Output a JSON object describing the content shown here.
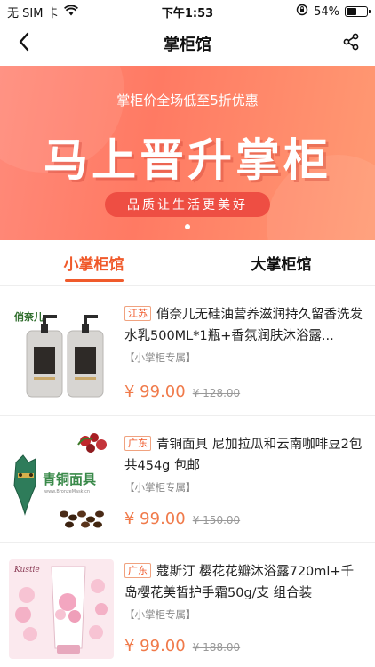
{
  "status_bar": {
    "carrier": "无 SIM 卡",
    "time": "下午1:53",
    "battery_percent": "54%",
    "battery_level": 0.54
  },
  "nav": {
    "title": "掌柜馆",
    "back_icon": "chevron-left-icon",
    "share_icon": "share-icon"
  },
  "banner": {
    "subtitle": "掌柜价全场低至5折优惠",
    "headline": "马上晋升掌柜",
    "pill_text": "品质让生活更美好",
    "colors": {
      "start": "#ff8a7a",
      "end": "#ff9a73",
      "pill": "#ee4e43"
    }
  },
  "tabs": [
    {
      "label": "小掌柜馆",
      "active": true
    },
    {
      "label": "大掌柜馆",
      "active": false
    }
  ],
  "accent_color": "#f05a2b",
  "products": [
    {
      "region": "江苏",
      "title": "俏奈儿无硅油营养滋润持久留香洗发水乳500ML*1瓶+香氛润肤沐浴露...",
      "tag": "【小掌柜专属】",
      "price": "¥ 99.00",
      "old_price": "¥ 128.00",
      "image_icon": "shampoo-bottles-image",
      "brand_text": "俏奈儿"
    },
    {
      "region": "广东",
      "title": "青铜面具 尼加拉瓜和云南咖啡豆2包共454g 包邮",
      "tag": "【小掌柜专属】",
      "price": "¥ 99.00",
      "old_price": "¥ 150.00",
      "image_icon": "bronze-mask-coffee-image",
      "brand_text": "青铜面具"
    },
    {
      "region": "广东",
      "title": "蔻斯汀 樱花花瓣沐浴露720ml+千岛樱花美皙护手霜50g/支 组合装",
      "tag": "【小掌柜专属】",
      "price": "¥ 99.00",
      "old_price": "¥ 188.00",
      "image_icon": "sakura-lotion-image",
      "brand_text": "Kustie"
    }
  ]
}
